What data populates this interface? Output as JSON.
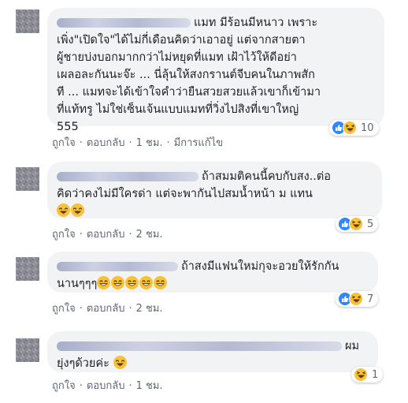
{
  "comments": [
    {
      "lines": [
        "แมท มีร้อนมีหนาว เพราะ",
        "เพิ่ง\"เปิดใจ\"ได้ไม่กี่เดือนคิดว่าเอาอยู่ แต่จากสายตา",
        "ผู้ชายบ่งบอกมากกว่าไม่หยุดที่แมท เฝ้าไว้ให้ดีอย่า",
        "เผลอละกันนะจ๊ะ ... นี่ลุ้นให้สงกรานต์จีบคนในภาพสัก",
        "ที ... แมทจะได้เข้าใจคำว่ายืนสวยสวยแล้วเขาก็เข้ามา",
        "ที่แท้ทรู ไม่ใช่เซ็นเจ้นแบบแมทที่วิ่งไปสิงที่เขาใหญ่",
        "555"
      ],
      "like": "ถูกใจ",
      "reply": "ตอบกลับ",
      "time": "1 ชม.",
      "edited": "มีการแก้ไข",
      "reaction_count": "10",
      "reactions": [
        "like-icon",
        "haha-icon"
      ]
    },
    {
      "lines": [
        "ถ้าสมมติคนนี้คบกับสง..ต่อ",
        "คิดว่าคงไม่มีใครด่า แต่จะพากันไปสมน้ำหน้า ม แทน"
      ],
      "like": "ถูกใจ",
      "reply": "ตอบกลับ",
      "time": "2 ชม.",
      "reaction_count": "5",
      "reactions": [
        "like-icon",
        "haha-icon"
      ]
    },
    {
      "lines": [
        "ถ้าสงมีแฟนใหม่กุจะอวยให้รักกัน",
        "นานๆๆๆ"
      ],
      "like": "ถูกใจ",
      "reply": "ตอบกลับ",
      "time": "2 ชม.",
      "reaction_count": "7",
      "reactions": [
        "like-icon",
        "haha-icon"
      ]
    },
    {
      "lines": [
        "ผม",
        "ยุ่งๆด้วยค่ะ"
      ],
      "like": "ถูกใจ",
      "reply": "ตอบกลับ",
      "time": "1 ชม.",
      "reaction_count": "1",
      "reactions": [
        "haha-icon"
      ]
    }
  ],
  "separator": "·",
  "colors": {
    "bubble": "#f2f3f5",
    "like": "#2d88ff",
    "haha": "#f7c23a",
    "meta": "#606770",
    "text": "#1c1e21"
  }
}
